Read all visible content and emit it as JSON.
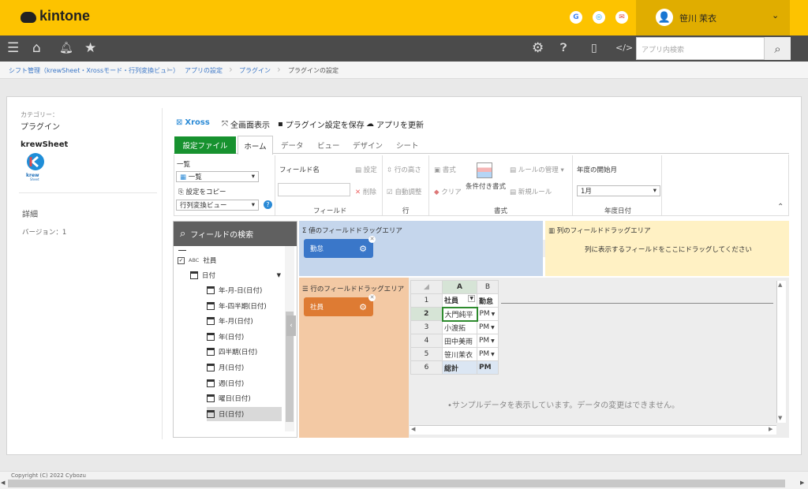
{
  "app": {
    "logo_text": "kintone"
  },
  "header": {
    "user_name": "笹川 茉衣",
    "services": [
      {
        "letter": "G",
        "color": "#4285f4"
      },
      {
        "letter": "o",
        "color": "#1a9ee6"
      },
      {
        "letter": "✉",
        "color": "#e8503a"
      }
    ]
  },
  "navbar": {
    "search_placeholder": "アプリ内検索"
  },
  "breadcrumb": [
    "シフト管理（krewSheet・Xrossモード・行列変換ビュー）",
    "アプリの設定",
    "プラグイン",
    "プラグインの設定"
  ],
  "sidebar": {
    "category_label": "カテゴリー：",
    "category_value": "プラグイン",
    "plugin_name": "krewSheet",
    "plugin_logo_text": "krew",
    "plugin_logo_sub": "Sheet",
    "detail_label": "詳細",
    "version": "バージョン：1"
  },
  "toolbar": {
    "xross": "Xross",
    "fullscreen": "全画面表示",
    "save": "プラグイン設定を保存",
    "update": "アプリを更新"
  },
  "ribbon_tabs": {
    "file": "設定ファイル",
    "home": "ホーム",
    "data": "データ",
    "view": "ビュー",
    "design": "デザイン",
    "sheet": "シート"
  },
  "ribbon": {
    "list_label": "一覧",
    "list_select": "一覧",
    "copy_settings": "設定をコピー",
    "view_select": "行列変換ビュー",
    "field_name_label": "フィールド名",
    "settings": "設定",
    "delete": "削除",
    "field_group": "フィールド",
    "row_height": "行の高さ",
    "auto_adjust": "自動調整",
    "row_group": "行",
    "format": "書式",
    "clear": "クリア",
    "conditional_format": "条件付き書式",
    "rule_manage": "ルールの管理",
    "new_rule": "新規ルール",
    "format_group": "書式",
    "fiscal_label": "年度の開始月",
    "fiscal_value": "1月",
    "fiscal_group": "年度日付"
  },
  "field_panel": {
    "search_label": "フィールドの検索",
    "item_employee": "社員",
    "employee_prefix": "ABC",
    "item_date": "日付",
    "date_items": [
      "年-月-日(日付)",
      "年-四半期(日付)",
      "年-月(日付)",
      "年(日付)",
      "四半期(日付)",
      "月(日付)",
      "週(日付)",
      "曜日(日付)",
      "日(日付)"
    ]
  },
  "zones": {
    "value_title": "値のフィールドドラッグエリア",
    "value_chip": "勤怠",
    "column_title": "列のフィールドドラッグエリア",
    "column_hint": "列に表示するフィールドをここにドラッグしてください",
    "row_title": "行のフィールドドラッグエリア",
    "row_chip": "社員"
  },
  "grid": {
    "col_headers": [
      "A",
      "B"
    ],
    "rows": [
      {
        "num": "1",
        "a": "社員",
        "b": "勤怠"
      },
      {
        "num": "2",
        "a": "大門純平",
        "b": "PM"
      },
      {
        "num": "3",
        "a": "小渡拓",
        "b": "PM"
      },
      {
        "num": "4",
        "a": "田中美雨",
        "b": "PM"
      },
      {
        "num": "5",
        "a": "笹川茉衣",
        "b": "PM"
      },
      {
        "num": "6",
        "a": "総計",
        "b": "PM"
      }
    ],
    "sample_note": "•サンプルデータを表示しています。データの変更はできません。"
  },
  "footer": {
    "copyright": "Copyright (C) 2022 Cybozu"
  },
  "colors": {
    "brand": "#fdc300",
    "file_tab": "#17922f",
    "value_zone": "#c5d6ec",
    "column_zone": "#fff1c4",
    "row_zone": "#f3c9a4"
  }
}
